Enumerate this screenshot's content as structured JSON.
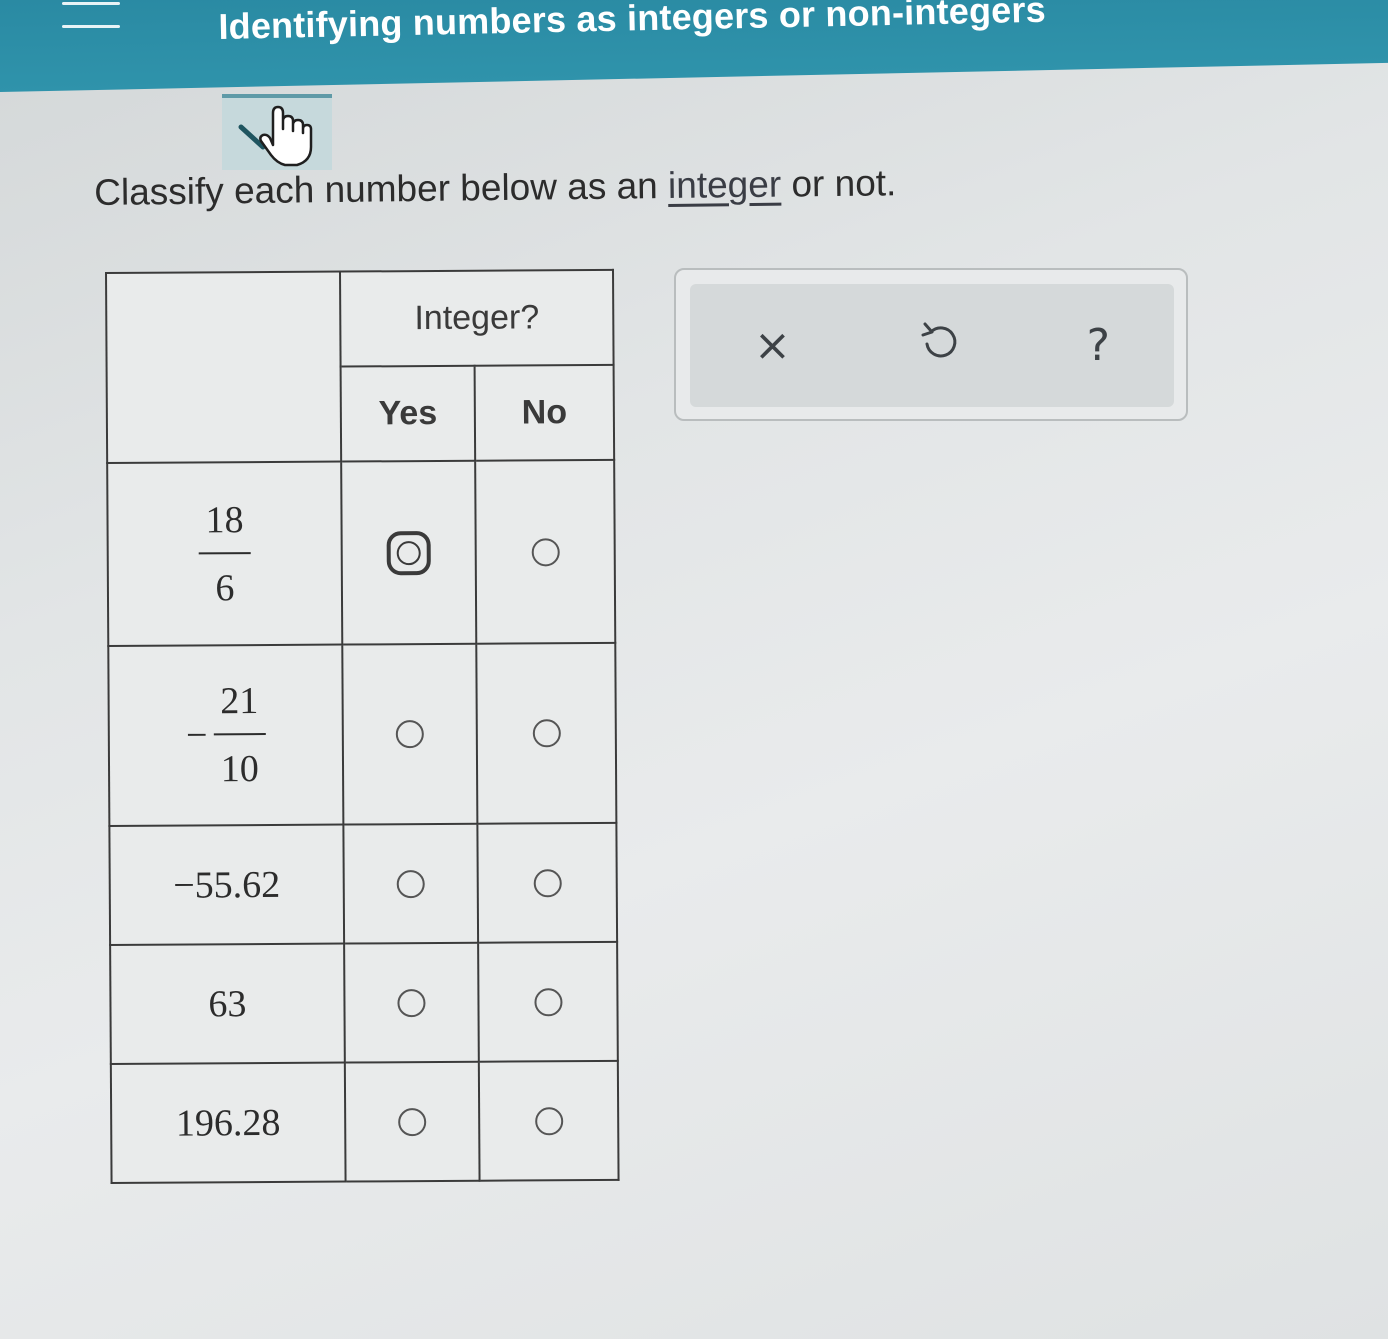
{
  "header": {
    "title": "Identifying numbers as integers or non-integers",
    "accent_color": "#2f8ea6"
  },
  "explanation_tab": {
    "icon": "pointer-hand-icon"
  },
  "question": {
    "prefix": "Classify each number below as an ",
    "link": "integer",
    "suffix": " or not."
  },
  "table": {
    "group_header": "Integer?",
    "columns": [
      "Yes",
      "No"
    ],
    "rows": [
      {
        "number": "18/6",
        "display": {
          "sign": "",
          "numerator": "18",
          "denominator": "6"
        },
        "selected": "Yes"
      },
      {
        "number": "-21/10",
        "display": {
          "sign": "−",
          "numerator": "21",
          "denominator": "10"
        },
        "selected": null
      },
      {
        "number": "−55.62",
        "display": {
          "text": "−55.62"
        },
        "selected": null
      },
      {
        "number": "63",
        "display": {
          "text": "63"
        },
        "selected": null
      },
      {
        "number": "196.28",
        "display": {
          "text": "196.28"
        },
        "selected": null
      }
    ]
  },
  "toolbox": {
    "clear": "×",
    "undo_icon": "undo-icon",
    "help": "?"
  }
}
